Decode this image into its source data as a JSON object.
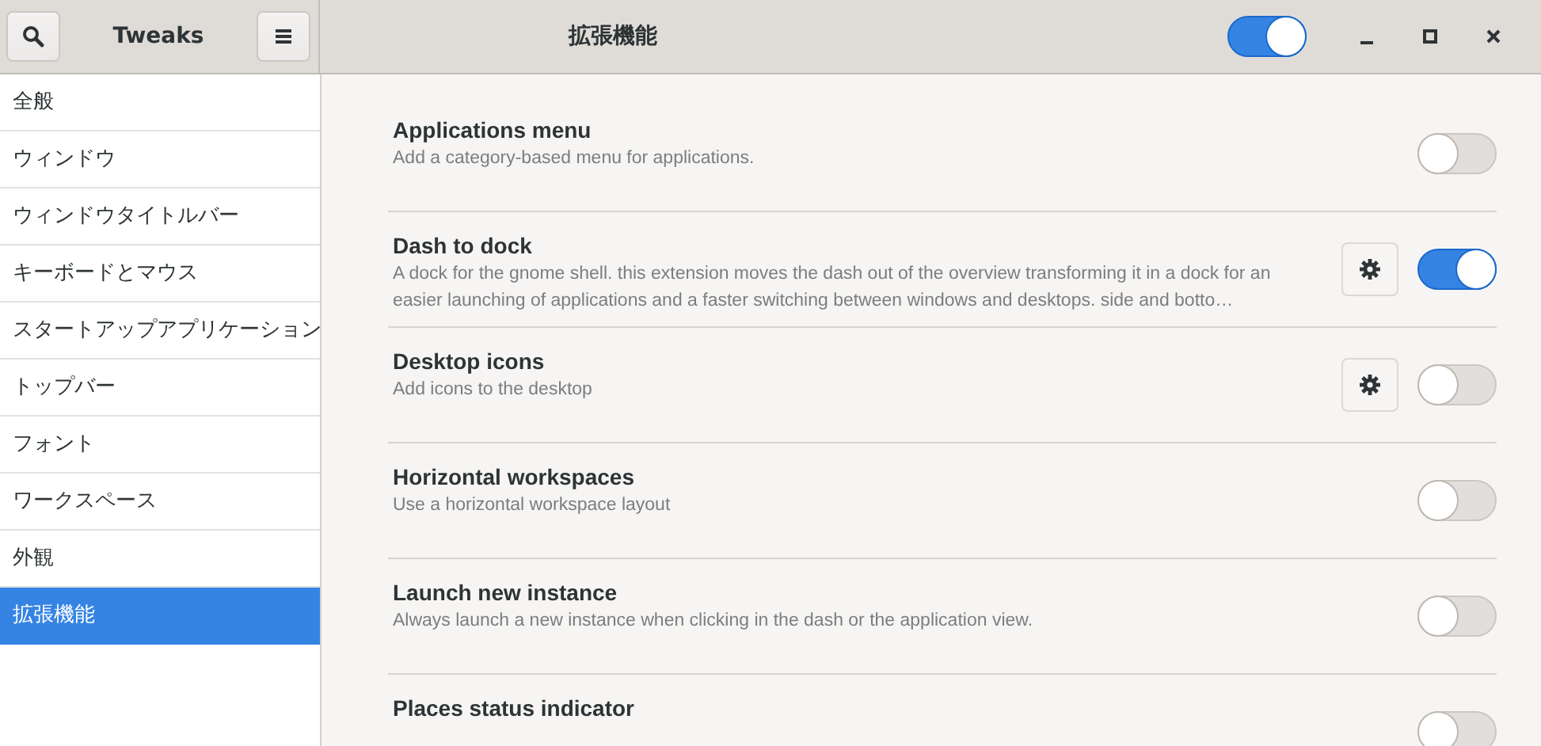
{
  "sidebar_header": {
    "title": "Tweaks"
  },
  "header": {
    "title": "拡張機能",
    "master_switch": {
      "on": true
    }
  },
  "sidebar": {
    "items": [
      {
        "label": "全般",
        "selected": false
      },
      {
        "label": "ウィンドウ",
        "selected": false
      },
      {
        "label": "ウィンドウタイトルバー",
        "selected": false
      },
      {
        "label": "キーボードとマウス",
        "selected": false
      },
      {
        "label": "スタートアップアプリケーション",
        "selected": false
      },
      {
        "label": "トップバー",
        "selected": false
      },
      {
        "label": "フォント",
        "selected": false
      },
      {
        "label": "ワークスペース",
        "selected": false
      },
      {
        "label": "外観",
        "selected": false
      },
      {
        "label": "拡張機能",
        "selected": true
      }
    ]
  },
  "extensions": [
    {
      "name": "Applications menu",
      "description": "Add a category-based menu for applications.",
      "settings": false,
      "on": false
    },
    {
      "name": "Dash to dock",
      "description": "A dock for the gnome shell. this extension moves the dash out of the overview transforming it in a dock for an easier launching of applications and a faster switching between windows and desktops. side and botto…",
      "settings": true,
      "on": true
    },
    {
      "name": "Desktop icons",
      "description": "Add icons to the desktop",
      "settings": true,
      "on": false
    },
    {
      "name": "Horizontal workspaces",
      "description": "Use a horizontal workspace layout",
      "settings": false,
      "on": false
    },
    {
      "name": "Launch new instance",
      "description": "Always launch a new instance when clicking in the dash or the application view.",
      "settings": false,
      "on": false
    },
    {
      "name": "Places status indicator",
      "settings": false,
      "on": false
    }
  ]
}
